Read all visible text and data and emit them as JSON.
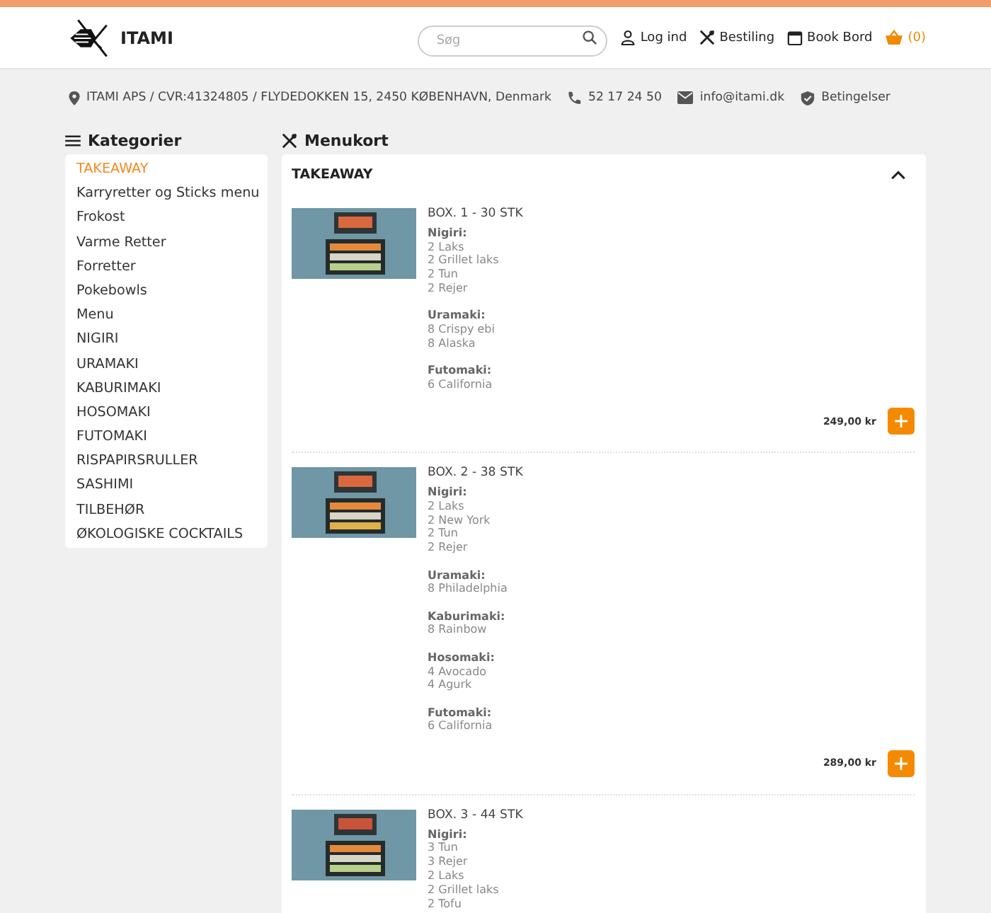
{
  "header": {
    "logo_text": "ITAMI",
    "search": {
      "placeholder": "Søg"
    },
    "nav": [
      {
        "kind": "user",
        "label": "Log ind"
      },
      {
        "kind": "cutlery",
        "label": "Bestiling"
      },
      {
        "kind": "calendar",
        "label": "Book Bord"
      }
    ],
    "cart": {
      "count": "(0)"
    }
  },
  "info_bar": [
    {
      "kind": "pin",
      "text": "ITAMI APS / CVR:41324805 / FLYDEDOKKEN 15, 2450 KØBENHAVN, Denmark"
    },
    {
      "kind": "phone",
      "text": "52 17 24 50"
    },
    {
      "kind": "mail",
      "text": "info@itami.dk"
    },
    {
      "kind": "shield",
      "text": "Betingelser"
    }
  ],
  "sidebar": {
    "title": "Kategorier",
    "items": [
      {
        "label": "TAKEAWAY",
        "selected": true
      },
      {
        "label": "Karryretter og Sticks menu",
        "selected": false
      },
      {
        "label": "Frokost",
        "selected": false
      },
      {
        "label": "Varme Retter",
        "selected": false
      },
      {
        "label": "Forretter",
        "selected": false
      },
      {
        "label": "Pokebowls",
        "selected": false
      },
      {
        "label": "Menu",
        "selected": false
      },
      {
        "label": "NIGIRI",
        "selected": false
      },
      {
        "label": "URAMAKI",
        "selected": false
      },
      {
        "label": "KABURIMAKI",
        "selected": false
      },
      {
        "label": "HOSOMAKI",
        "selected": false
      },
      {
        "label": "FUTOMAKI",
        "selected": false
      },
      {
        "label": "RISPAPIRSRULLER",
        "selected": false
      },
      {
        "label": "SASHIMI",
        "selected": false
      },
      {
        "label": "TILBEHØR",
        "selected": false
      },
      {
        "label": "ØKOLOGISKE COCKTAILS",
        "selected": false
      }
    ]
  },
  "menu": {
    "title": "Menukort",
    "section": {
      "title": "TAKEAWAY",
      "expanded": true
    },
    "items": [
      {
        "name": "BOX. 1 - 30 STK",
        "groups": [
          {
            "heading": "Nigiri:",
            "lines": [
              "2 Laks",
              "2 Grillet laks",
              "2 Tun",
              "2 Rejer"
            ]
          },
          {
            "heading": "Uramaki:",
            "lines": [
              "8 Crispy ebi",
              "8 Alaska"
            ]
          },
          {
            "heading": "Futomaki:",
            "lines": [
              "6 California"
            ]
          }
        ],
        "price": "249,00 kr"
      },
      {
        "name": "BOX. 2 - 38 STK",
        "groups": [
          {
            "heading": "Nigiri:",
            "lines": [
              "2 Laks",
              "2 New York",
              "2 Tun",
              "2 Rejer"
            ]
          },
          {
            "heading": "Uramaki:",
            "lines": [
              "8 Philadelphia"
            ]
          },
          {
            "heading": "Kaburimaki:",
            "lines": [
              "8 Rainbow"
            ]
          },
          {
            "heading": "Hosomaki:",
            "lines": [
              "4 Avocado",
              "4 Agurk"
            ]
          },
          {
            "heading": "Futomaki:",
            "lines": [
              "6 California"
            ]
          }
        ],
        "price": "289,00 kr"
      },
      {
        "name": "BOX. 3 - 44 STK",
        "groups": [
          {
            "heading": "Nigiri:",
            "lines": [
              "3 Tun",
              "3 Rejer",
              "2 Laks",
              "2 Grillet laks",
              "2 Tofu"
            ]
          }
        ]
      }
    ]
  }
}
